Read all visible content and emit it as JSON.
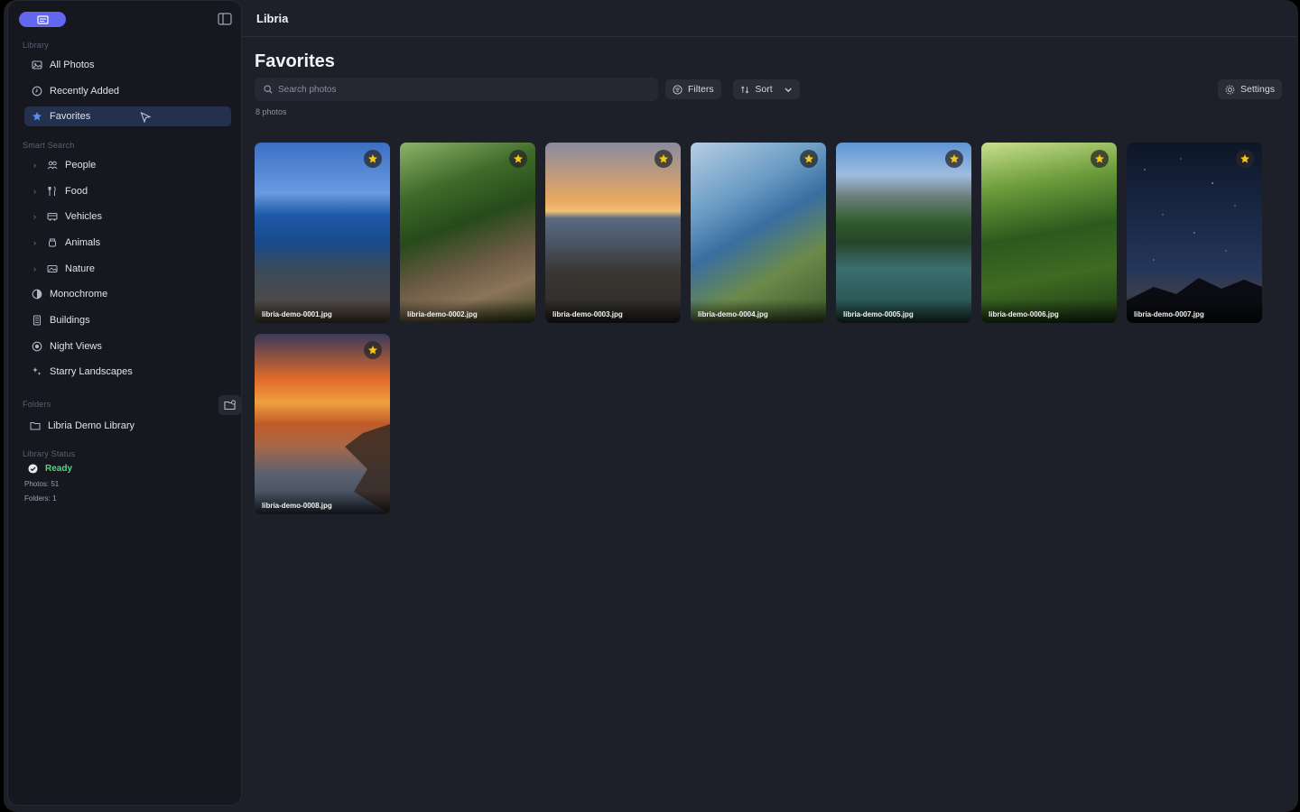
{
  "app": {
    "title": "Libria"
  },
  "sidebar": {
    "library_label": "Library",
    "library_items": [
      {
        "label": "All Photos",
        "icon": "photos-icon"
      },
      {
        "label": "Recently Added",
        "icon": "clock-icon"
      },
      {
        "label": "Favorites",
        "icon": "star-icon",
        "active": true
      }
    ],
    "smart_search_label": "Smart Search",
    "smart_items": [
      {
        "label": "People",
        "icon": "people-icon"
      },
      {
        "label": "Food",
        "icon": "fork-knife-icon"
      },
      {
        "label": "Vehicles",
        "icon": "bus-icon"
      },
      {
        "label": "Animals",
        "icon": "paw-icon"
      },
      {
        "label": "Nature",
        "icon": "leaf-icon"
      }
    ],
    "plain_items": [
      {
        "label": "Monochrome",
        "icon": "contrast-icon"
      },
      {
        "label": "Buildings",
        "icon": "building-icon"
      },
      {
        "label": "Night Views",
        "icon": "moon-icon"
      },
      {
        "label": "Starry Landscapes",
        "icon": "sparkle-icon"
      }
    ],
    "folders_label": "Folders",
    "folders": [
      {
        "label": "Libria Demo Library"
      }
    ],
    "status_label": "Library Status",
    "status": {
      "state": "Ready",
      "photos": "Photos: 51",
      "folders": "Folders: 1"
    }
  },
  "main": {
    "title": "Favorites",
    "search_placeholder": "Search photos",
    "filters_label": "Filters",
    "sort_label": "Sort",
    "settings_label": "Settings",
    "count": "8 photos",
    "photos": [
      {
        "name": "libria-demo-0001.jpg"
      },
      {
        "name": "libria-demo-0002.jpg"
      },
      {
        "name": "libria-demo-0003.jpg"
      },
      {
        "name": "libria-demo-0004.jpg"
      },
      {
        "name": "libria-demo-0005.jpg"
      },
      {
        "name": "libria-demo-0006.jpg"
      },
      {
        "name": "libria-demo-0007.jpg"
      },
      {
        "name": "libria-demo-0008.jpg"
      }
    ]
  },
  "colors": {
    "accent": "#6366f1",
    "ready": "#4ade80",
    "star": "#f5c518",
    "active_bg": "#23314f"
  }
}
